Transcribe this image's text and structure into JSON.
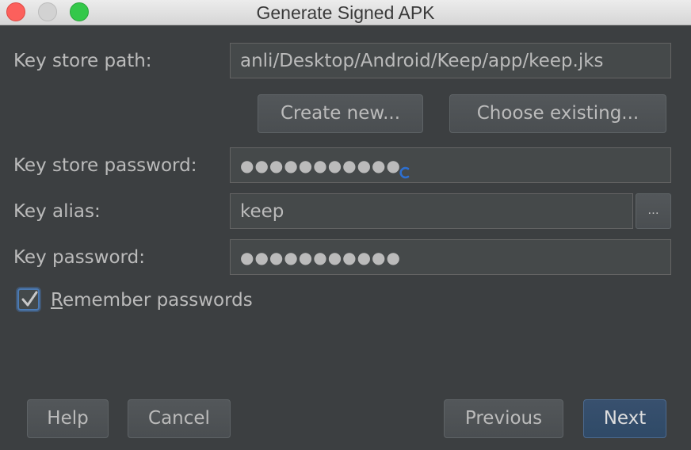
{
  "window": {
    "title": "Generate Signed APK"
  },
  "form": {
    "key_store_path": {
      "label": "Key store path:",
      "value": "anli/Desktop/Android/Keep/app/keep.jks"
    },
    "create_new_label": "Create new...",
    "choose_existing_label": "Choose existing...",
    "key_store_password": {
      "label": "Key store password:",
      "value": "●●●●●●●●●●●"
    },
    "key_alias": {
      "label": "Key alias:",
      "value": "keep",
      "browse_label": "..."
    },
    "key_password": {
      "label": "Key password:",
      "value": "●●●●●●●●●●●"
    },
    "remember": {
      "mnemonic": "R",
      "rest": "emember passwords",
      "checked": true
    }
  },
  "footer": {
    "help_label": "Help",
    "cancel_label": "Cancel",
    "previous_label": "Previous",
    "next_label": "Next"
  },
  "colors": {
    "background": "#3c3f41",
    "field_background": "#45494a",
    "text": "#bbbbbb",
    "accent": "#4b7ab3",
    "default_button": "#2f4a67"
  },
  "icons": {
    "loading": "spinner-icon",
    "check": "checkmark-icon"
  }
}
